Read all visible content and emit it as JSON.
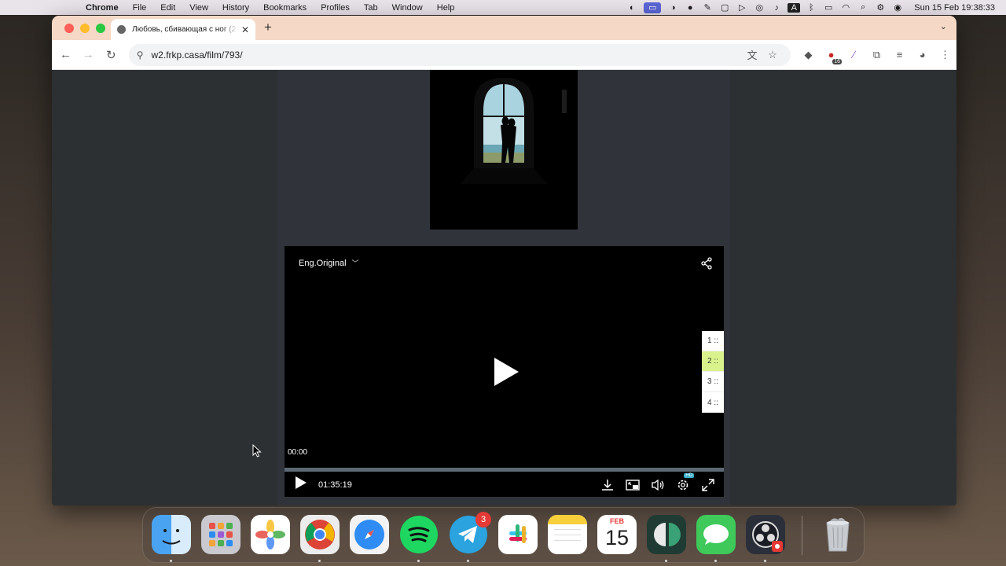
{
  "menubar": {
    "app_name": "Chrome",
    "menus": [
      "File",
      "Edit",
      "View",
      "History",
      "Bookmarks",
      "Profiles",
      "Tab",
      "Window",
      "Help"
    ],
    "clock": "Sun 15 Feb  19:38:33"
  },
  "browser": {
    "tab_title": "Любовь, сбивающая с ног (2",
    "url": "w2.frkp.casa/film/793/"
  },
  "player": {
    "audio_track": "Eng.Original",
    "current_time": "00:00",
    "duration": "01:35:19",
    "progress": 0,
    "quality_badge": "HD",
    "servers": [
      "1 ::",
      "2 ::",
      "3 ::",
      "4 ::"
    ],
    "active_server_index": 1
  },
  "dock": {
    "telegram_badge": "3",
    "calendar_month": "FEB",
    "calendar_day": "15"
  },
  "colors": {
    "page_bg": "#2c3032",
    "active_server": "#d9f28c",
    "tab_strip": "#f5d9c6"
  }
}
